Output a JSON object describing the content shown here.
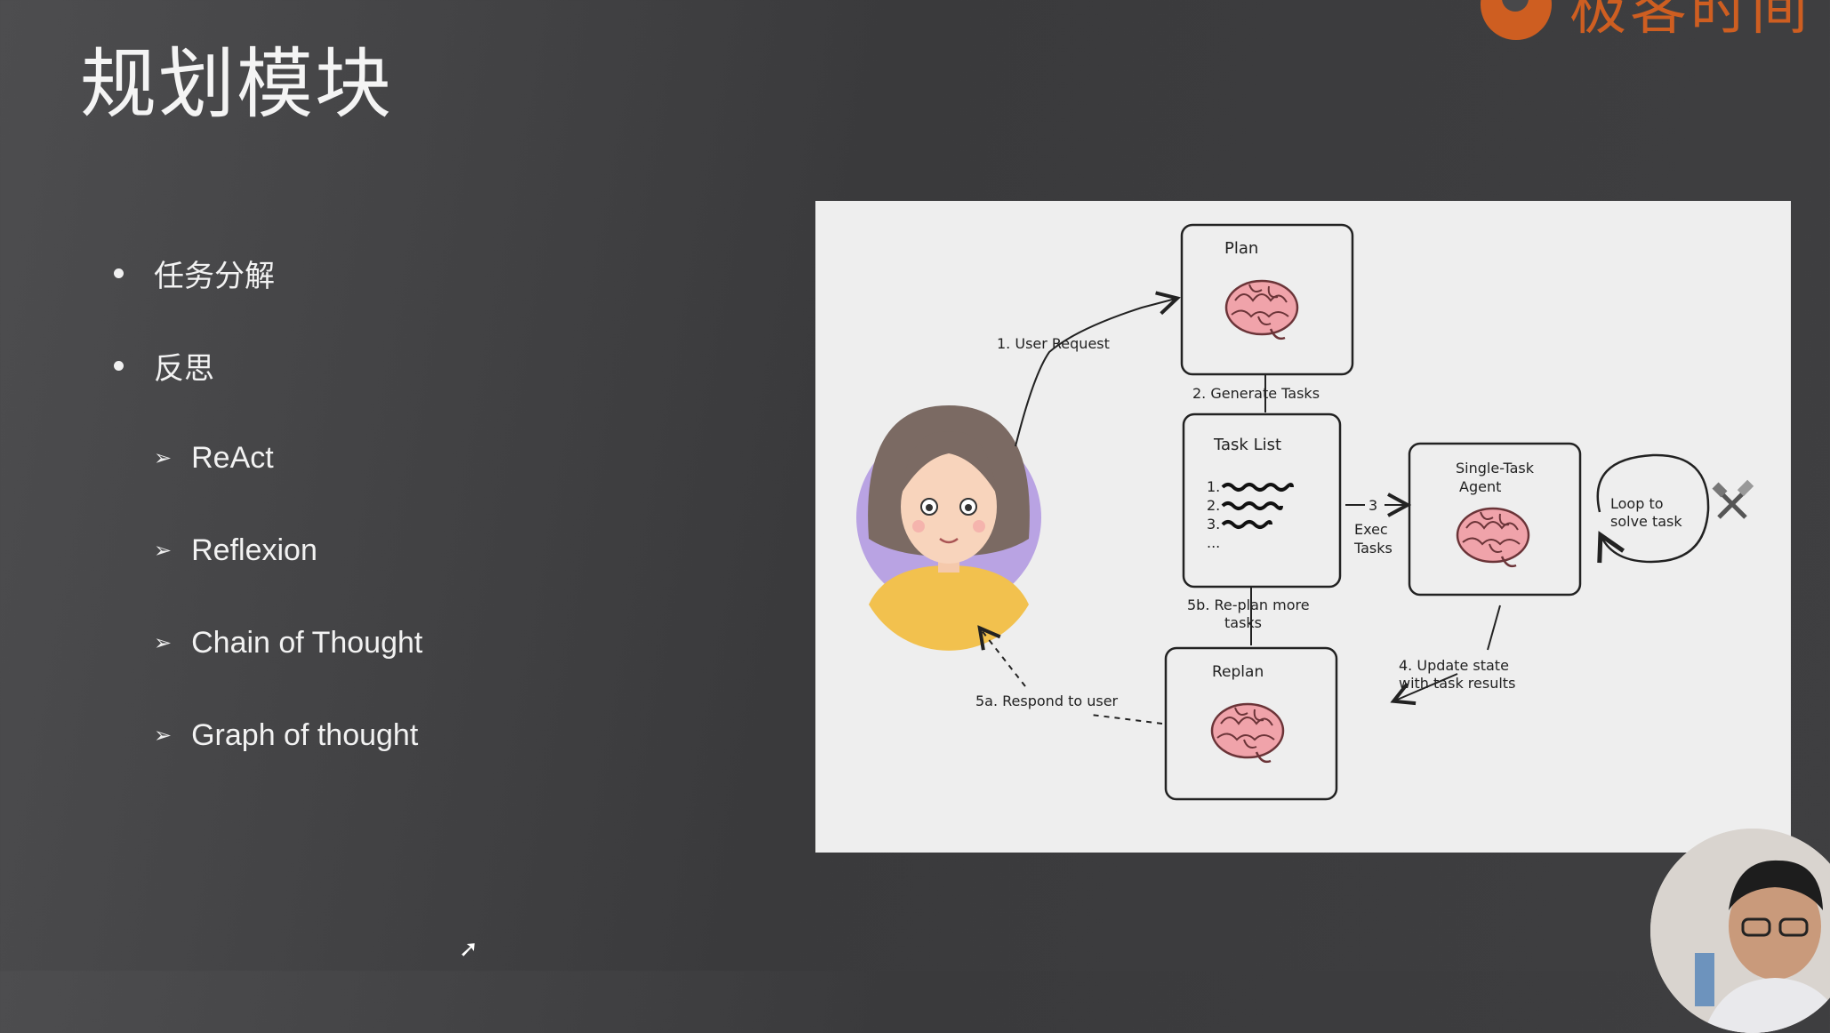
{
  "slide": {
    "title": "规划模块",
    "logo_text": "极客时间"
  },
  "bullets": [
    {
      "label": "任务分解",
      "level": 1
    },
    {
      "label": "反思",
      "level": 1
    },
    {
      "label": "ReAct",
      "level": 2
    },
    {
      "label": "Reflexion",
      "level": 2
    },
    {
      "label": "Chain of Thought",
      "level": 2
    },
    {
      "label": "Graph of thought",
      "level": 2
    }
  ],
  "diagram": {
    "plan_label": "Plan",
    "task_list_label": "Task List",
    "task_items": [
      "1.",
      "2.",
      "3.",
      "..."
    ],
    "agent_label_line1": "Single-Task",
    "agent_label_line2": "Agent",
    "replan_label": "Replan",
    "loop_line1": "Loop to",
    "loop_line2": "solve task",
    "step1": "1. User Request",
    "step2": "2. Generate Tasks",
    "step3_num": "3",
    "step3_line1": "Exec",
    "step3_line2": "Tasks",
    "step4_line1": "4. Update state",
    "step4_line2": "with task results",
    "step5a": "5a. Respond to user",
    "step5b_line1": "5b. Re-plan more",
    "step5b_line2": "tasks"
  },
  "colors": {
    "accent_orange": "#e8641c",
    "brain_pink": "#f0a3aa",
    "avatar_purple": "#b9a3e3"
  }
}
